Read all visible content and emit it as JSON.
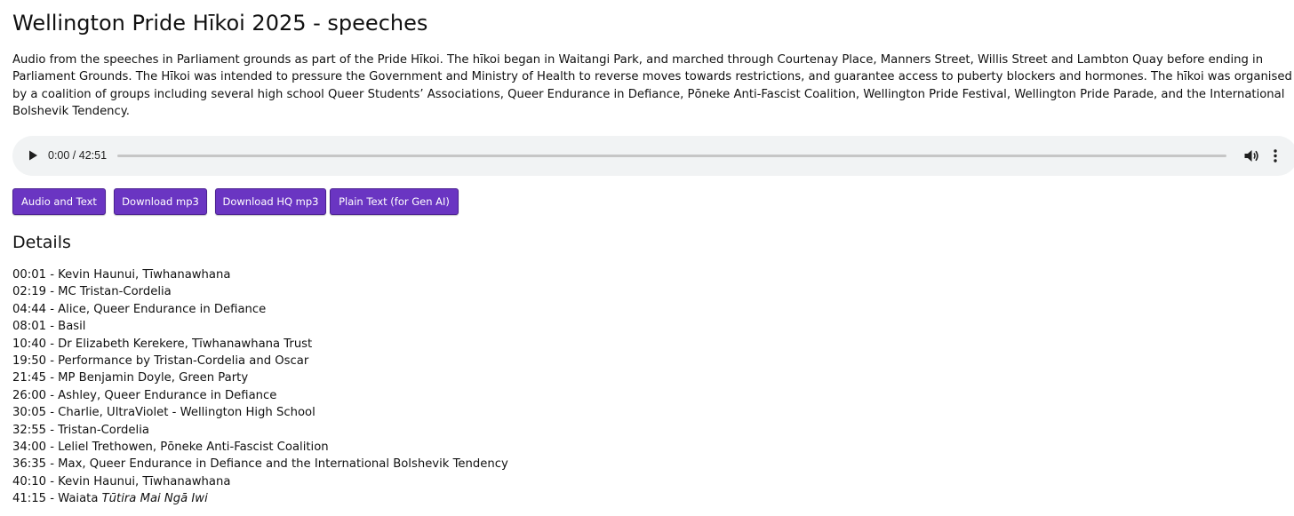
{
  "page": {
    "title": "Wellington Pride Hīkoi 2025 - speeches",
    "description": "Audio from the speeches in Parliament grounds as part of the Pride Hīkoi. The hīkoi began in Waitangi Park, and marched through Courtenay Place, Manners Street, Willis Street and Lambton Quay before ending in Parliament Grounds. The Hīkoi was intended to pressure the Government and Ministry of Health to reverse moves towards restrictions, and guarantee access to puberty blockers and hormones. The hīkoi was organised by a coalition of groups including several high school Queer Students’ Associations, Queer Endurance in Defiance, Pōneke Anti-Fascist Coalition, Wellington Pride Festival, Wellington Pride Parade, and the International Bolshevik Tendency."
  },
  "player": {
    "time_display": "0:00 / 42:51",
    "progress_fraction": 0,
    "icons": {
      "play": "play-icon",
      "volume": "volume-icon",
      "menu": "more-vertical-icon"
    }
  },
  "buttons": [
    {
      "label": "Audio and Text"
    },
    {
      "label": "Download mp3"
    },
    {
      "label": "Download HQ mp3"
    },
    {
      "label": "Plain Text (for Gen AI)"
    }
  ],
  "colors": {
    "button_bg": "#6a35c2",
    "player_bg": "#f1f3f4"
  },
  "details": {
    "heading": "Details",
    "tracks": [
      {
        "text": "00:01 - Kevin Haunui, Tīwhanawhana"
      },
      {
        "text": "02:19 - MC Tristan-Cordelia"
      },
      {
        "text": "04:44 - Alice, Queer Endurance in Defiance"
      },
      {
        "text": "08:01 - Basil"
      },
      {
        "text": "10:40 - Dr Elizabeth Kerekere, Tīwhanawhana Trust"
      },
      {
        "text": "19:50 - Performance by Tristan-Cordelia and Oscar"
      },
      {
        "text": "21:45 - MP Benjamin Doyle, Green Party"
      },
      {
        "text": "26:00 - Ashley, Queer Endurance in Defiance"
      },
      {
        "text": "30:05 - Charlie, UltraViolet - Wellington High School"
      },
      {
        "text": "32:55 - Tristan-Cordelia"
      },
      {
        "text": "34:00 - Leliel Trethowen, Pōneke Anti-Fascist Coalition"
      },
      {
        "text": "36:35 - Max, Queer Endurance in Defiance and the International Bolshevik Tendency"
      },
      {
        "text": "40:10 - Kevin Haunui, Tīwhanawhana"
      },
      {
        "text": "41:15 - Waiata ",
        "emph": "Tūtira Mai Ngā Iwi"
      }
    ]
  }
}
